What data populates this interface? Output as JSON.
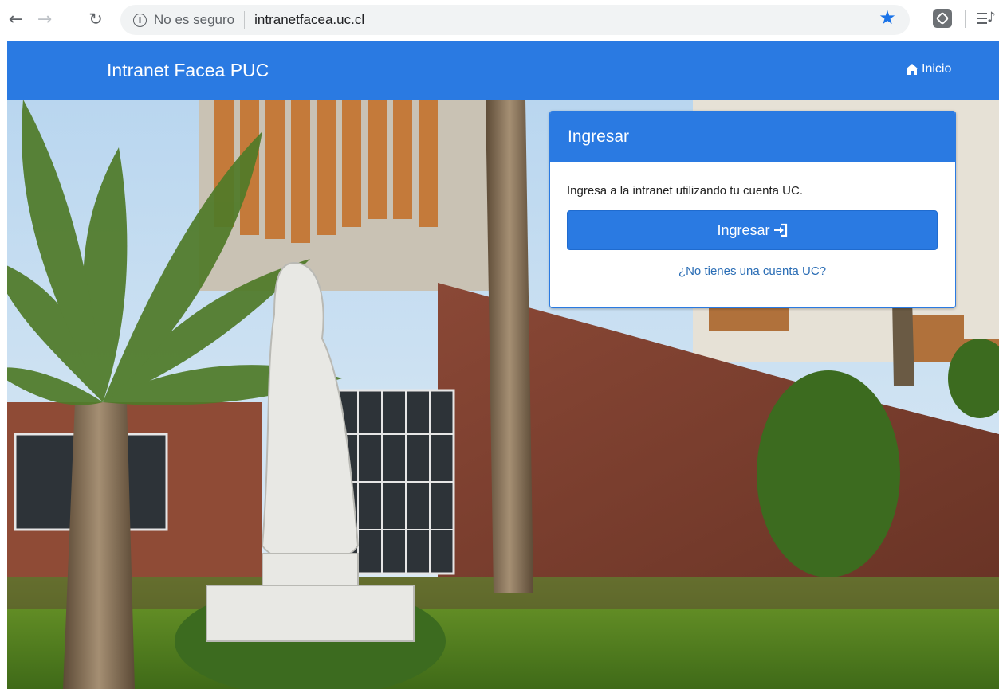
{
  "browser": {
    "back_icon": "arrow-left-icon",
    "forward_icon": "arrow-right-icon",
    "reload_icon": "reload-icon",
    "security_label": "No es seguro",
    "url": "intranetfacea.uc.cl",
    "bookmark_icon": "star-icon",
    "extension_icon": "extension-icon",
    "media_icon": "media-control-icon"
  },
  "navbar": {
    "brand": "Intranet Facea PUC",
    "home_label": "Inicio",
    "home_icon": "home-icon",
    "color": "#2a7ae2"
  },
  "login_card": {
    "title": "Ingresar",
    "description": "Ingresa a la intranet utilizando tu cuenta UC.",
    "button_label": "Ingresar",
    "button_icon": "sign-in-icon",
    "signup_link": "¿No tienes una cuenta UC?"
  },
  "colors": {
    "accent": "#2a7ae2",
    "link": "#2a6db5",
    "omnibox_bg": "#f1f3f4",
    "bookmark_star": "#1a73e8"
  }
}
